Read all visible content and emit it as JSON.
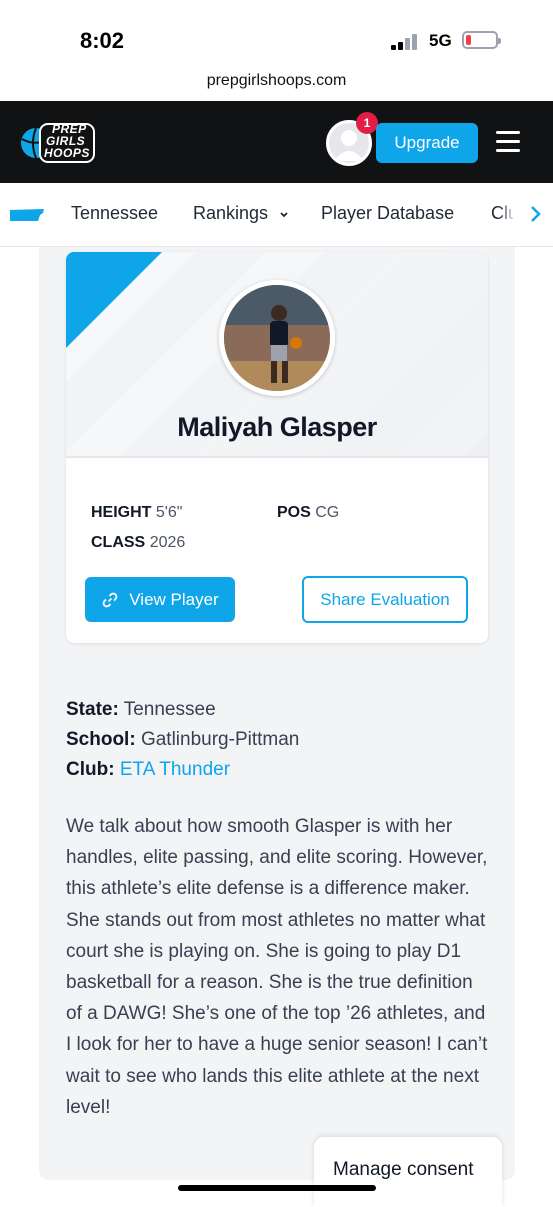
{
  "status_bar": {
    "time": "8:02",
    "network": "5G",
    "battery_level": 0.1,
    "battery_color": "#ef4444"
  },
  "browser": {
    "url": "prepgirlshoops.com"
  },
  "header": {
    "logo_lines": [
      "PREP",
      "GIRLS",
      "HOOPS"
    ],
    "notification_count": "1",
    "upgrade_label": "Upgrade",
    "accent_color": "#0ea5e9"
  },
  "subnav": {
    "items": [
      {
        "label": "Tennessee"
      },
      {
        "label": "Rankings"
      },
      {
        "label": "Player Database"
      },
      {
        "label": "Clubs"
      }
    ]
  },
  "player": {
    "name": "Maliyah Glasper",
    "height_label": "HEIGHT",
    "height": "5'6\"",
    "pos_label": "POS",
    "pos": "CG",
    "class_label": "CLASS",
    "class": "2026",
    "view_button": "View Player",
    "share_button": "Share Evaluation"
  },
  "details": {
    "state_label": "State:",
    "state": "Tennessee",
    "school_label": "School:",
    "school": "Gatlinburg-Pittman",
    "club_label": "Club:",
    "club": "ETA Thunder"
  },
  "evaluation": "We talk about how smooth Glasper is with her handles, elite passing, and elite scoring. However, this athlete’s elite defense is a difference maker. She stands out from most athletes no matter what court she is playing on. She is going to play D1 basketball for a reason. She is the true definition of a DAWG! She’s one of the top ’26 athletes, and I look for her to have a huge senior season! I can’t wait to see who lands this elite athlete at the next level!",
  "consent": {
    "label": "Manage consent"
  }
}
